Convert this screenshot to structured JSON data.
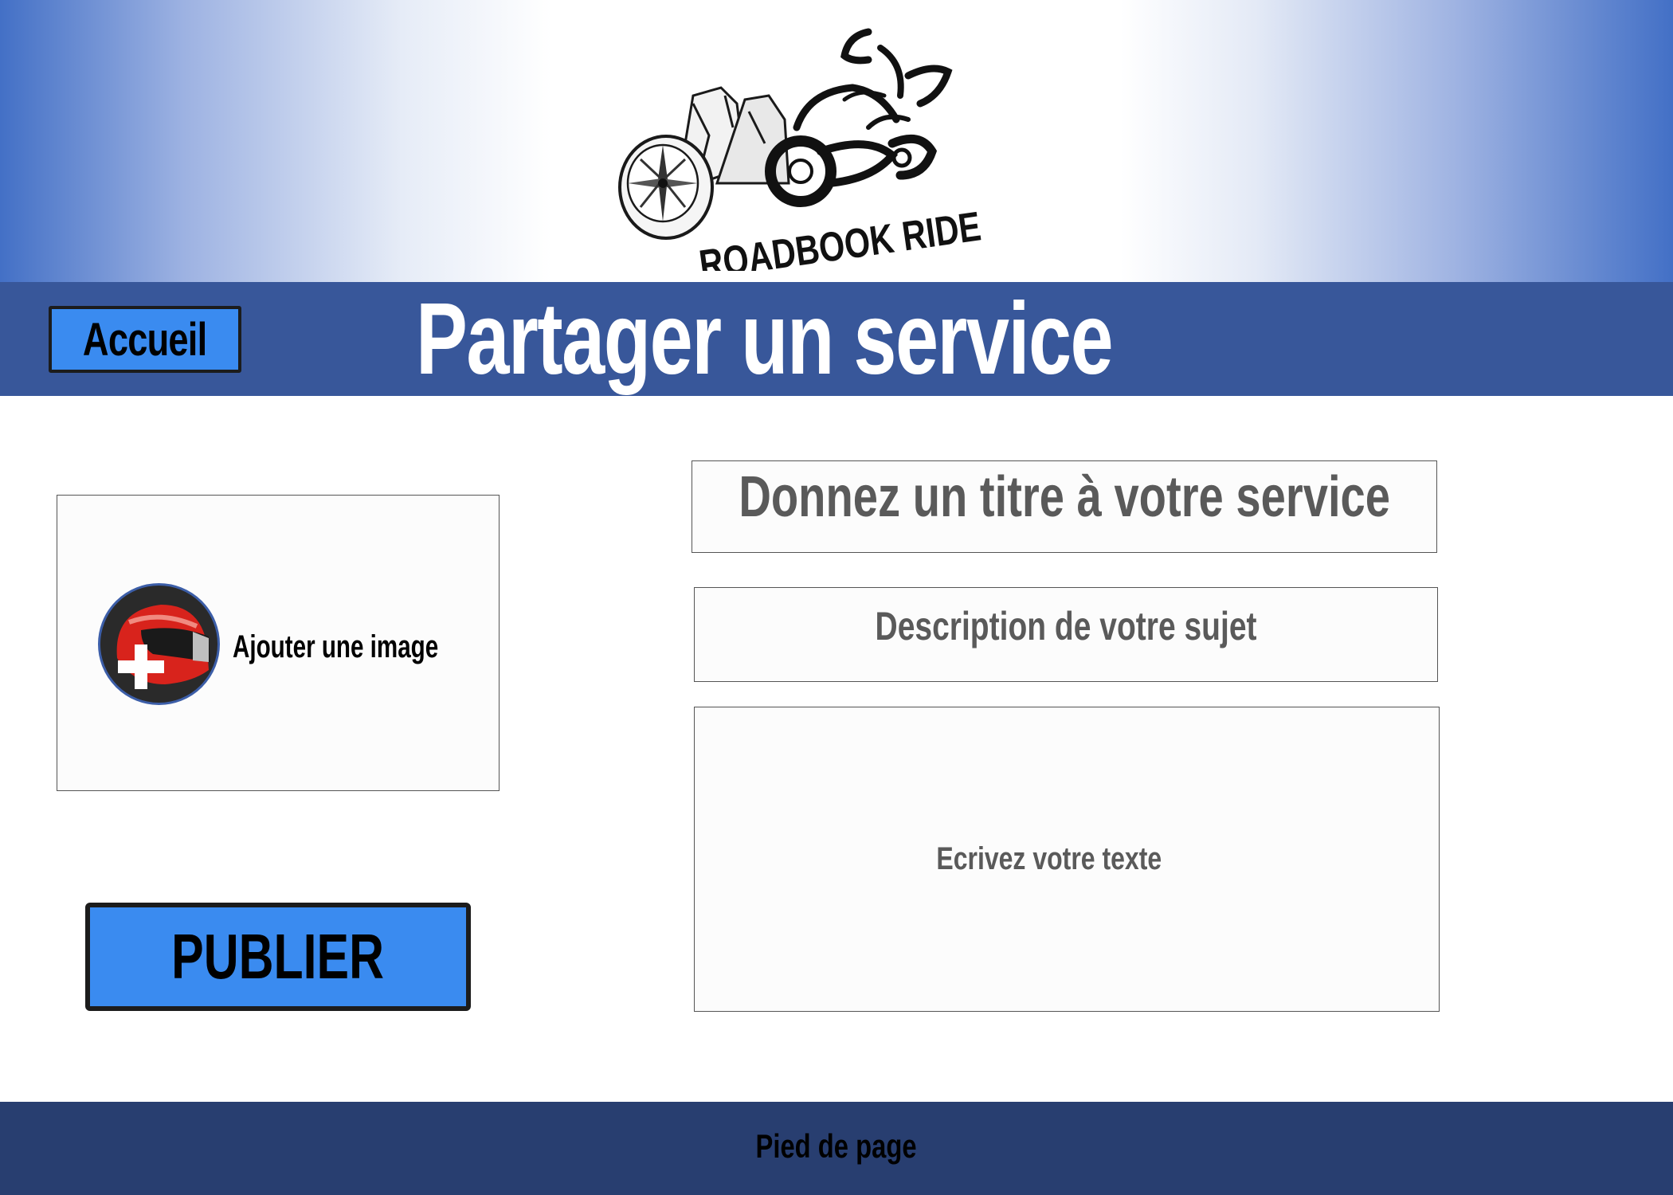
{
  "header": {
    "logo_text": "ROADBOOK RIDE",
    "logo_icons": [
      "compass-icon",
      "mountains-icon",
      "motorcycle-rider-icon"
    ]
  },
  "titlebar": {
    "home_label": "Accueil",
    "page_title": "Partager un service"
  },
  "image_upload": {
    "label": "Ajouter une image",
    "icon": "helmet-add-icon"
  },
  "publish": {
    "label": "PUBLIER"
  },
  "form": {
    "title_placeholder": "Donnez un titre à votre service",
    "subject_placeholder": "Description de votre sujet",
    "text_placeholder": "Ecrivez votre texte"
  },
  "footer": {
    "label": "Pied de page"
  },
  "colors": {
    "banner_edge": "#4370c6",
    "titlebar": "#38579a",
    "button": "#3a8bf0",
    "footer": "#283e70"
  }
}
